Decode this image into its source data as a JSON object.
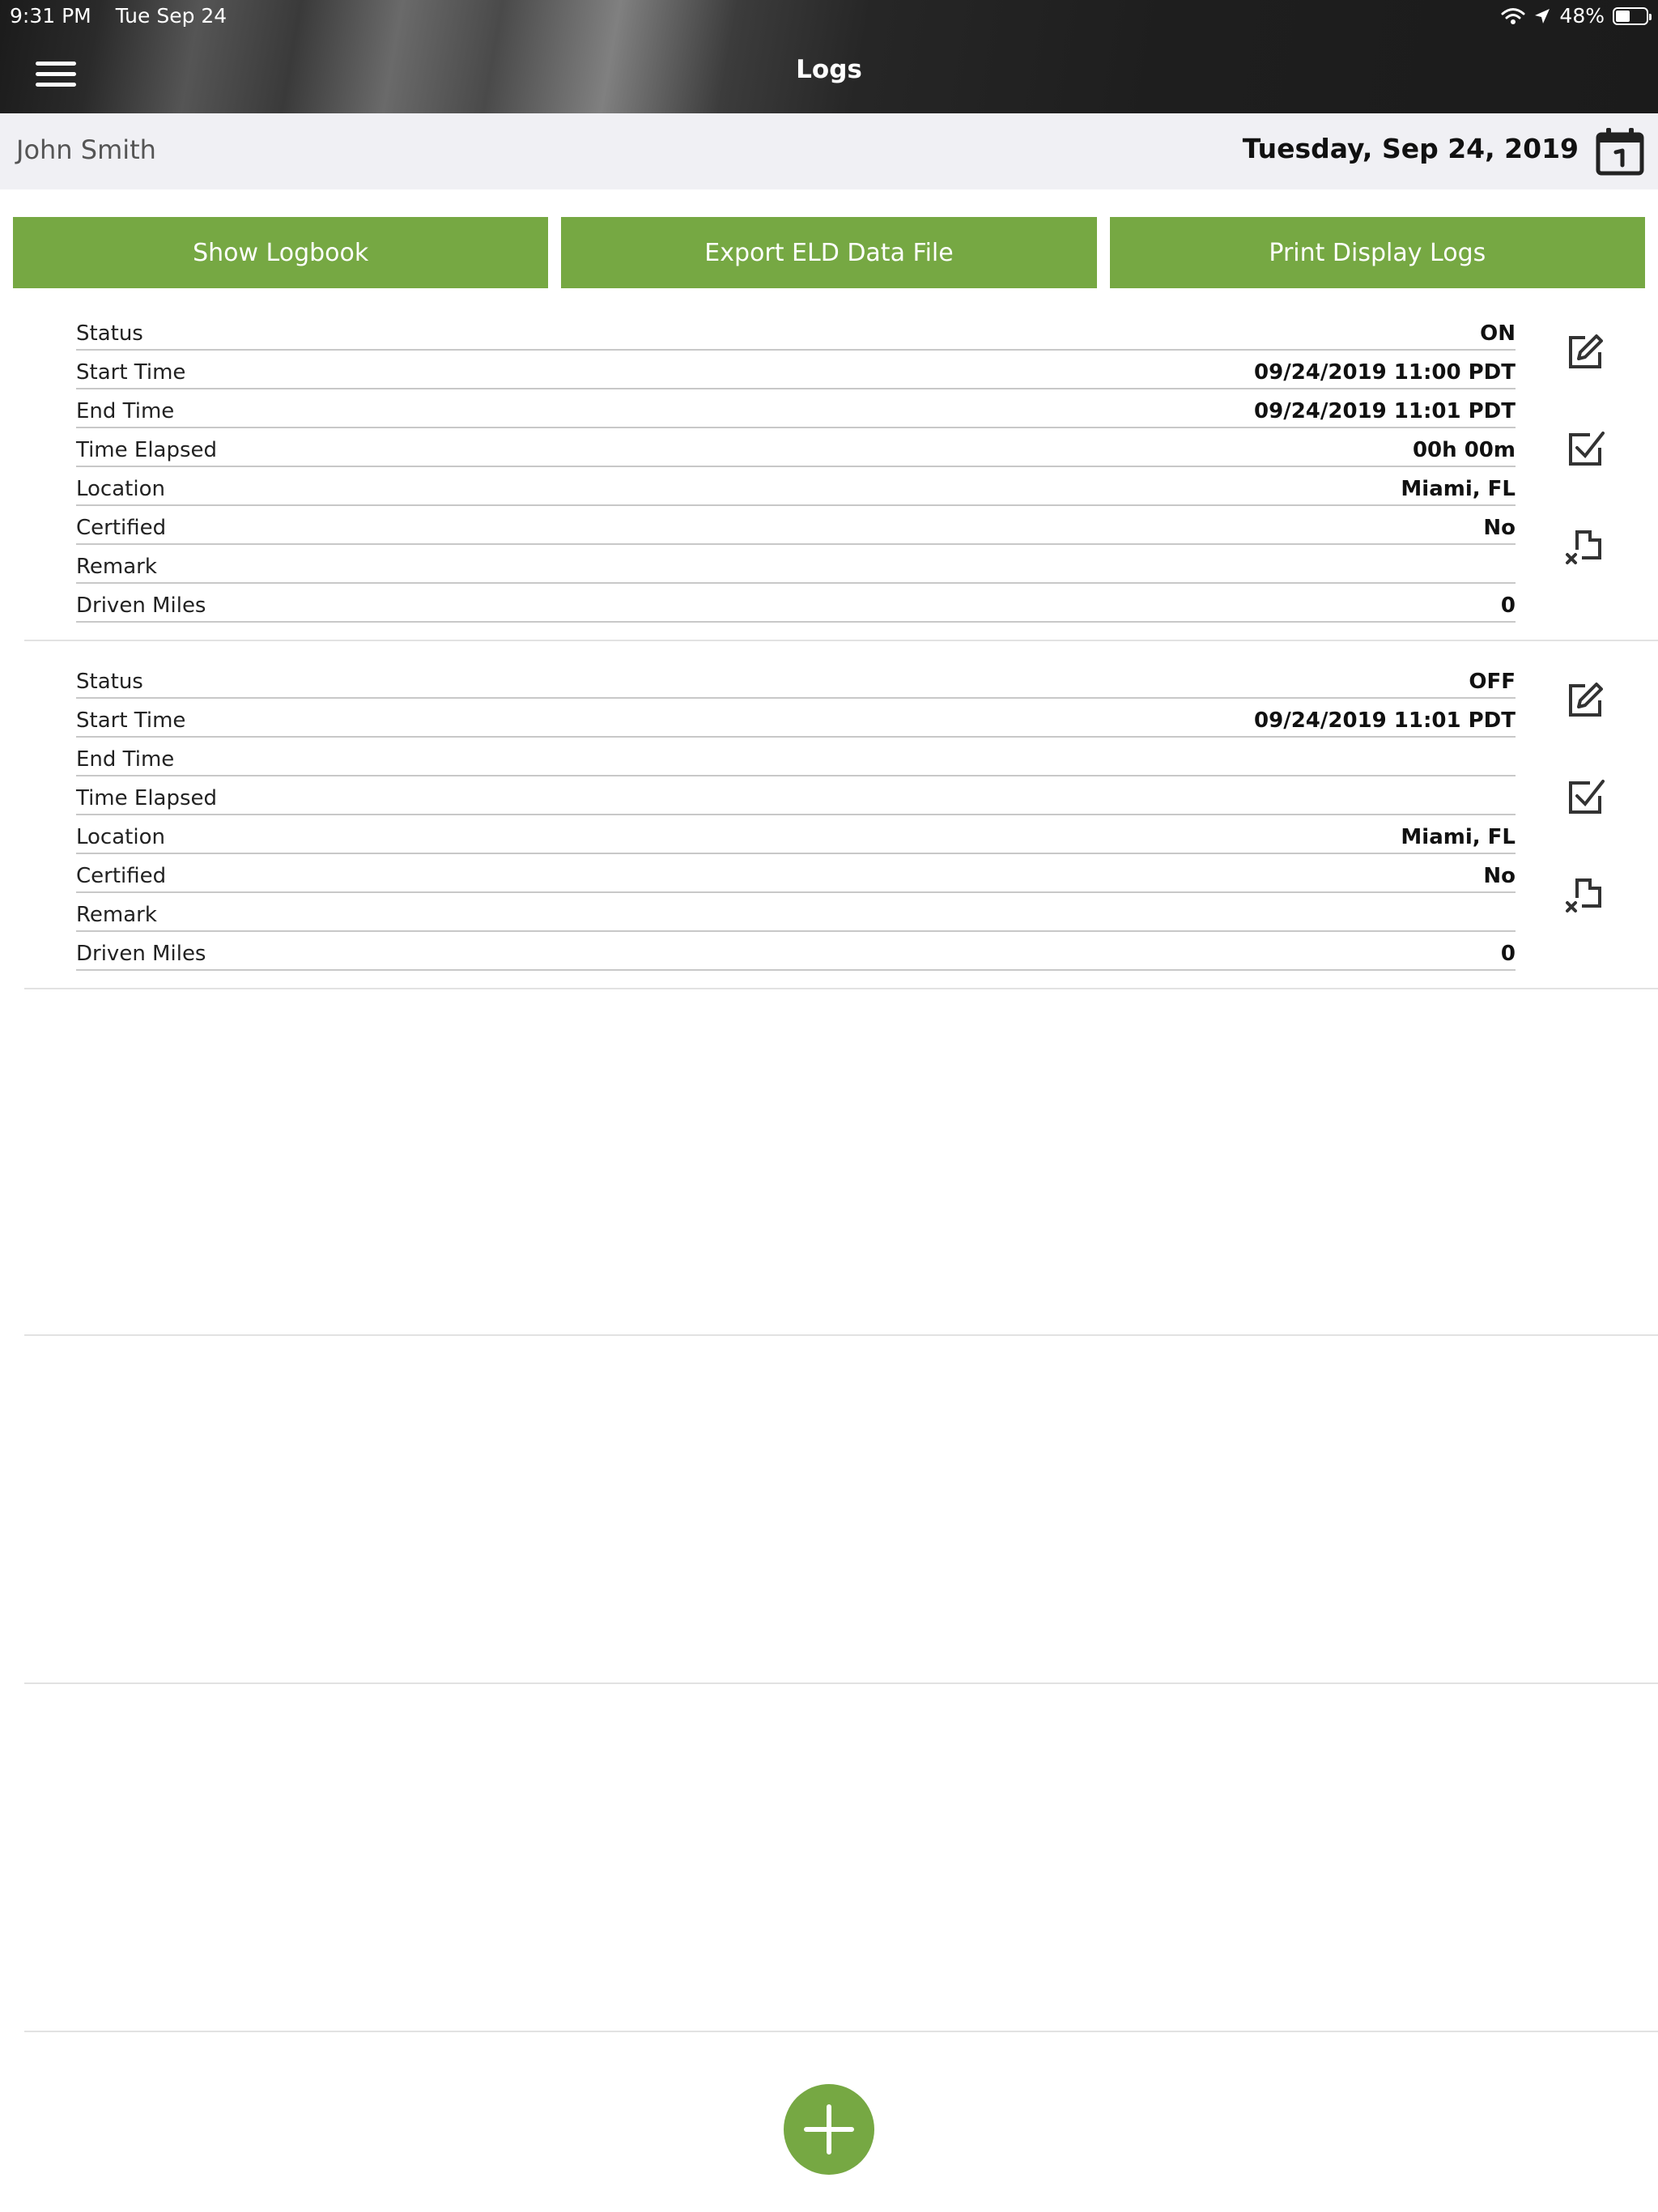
{
  "status_bar": {
    "time": "9:31 PM",
    "date": "Tue Sep 24",
    "battery": "48%",
    "battery_level": 0.48
  },
  "header": {
    "title": "Logs"
  },
  "subheader": {
    "driver_name": "John Smith",
    "date": "Tuesday, Sep 24, 2019"
  },
  "buttons": {
    "show_logbook": "Show Logbook",
    "export_eld": "Export ELD Data File",
    "print_logs": "Print Display Logs"
  },
  "logs": [
    {
      "status_label": "Status",
      "status": "ON",
      "start_label": "Start Time",
      "start": "09/24/2019 11:00 PDT",
      "end_label": "End Time",
      "end": "09/24/2019 11:01 PDT",
      "elapsed_label": "Time Elapsed",
      "elapsed": "00h 00m",
      "location_label": "Location",
      "location": "Miami, FL",
      "certified_label": "Certified",
      "certified": "No",
      "remark_label": "Remark",
      "remark": "",
      "miles_label": "Driven Miles",
      "miles": "0"
    },
    {
      "status_label": "Status",
      "status": "OFF",
      "start_label": "Start Time",
      "start": "09/24/2019 11:01 PDT",
      "end_label": "End Time",
      "end": "",
      "elapsed_label": "Time Elapsed",
      "elapsed": "",
      "location_label": "Location",
      "location": "Miami, FL",
      "certified_label": "Certified",
      "certified": "No",
      "remark_label": "Remark",
      "remark": "",
      "miles_label": "Driven Miles",
      "miles": "0"
    }
  ],
  "colors": {
    "accent": "#76a843",
    "header": "#1e1e1e"
  }
}
